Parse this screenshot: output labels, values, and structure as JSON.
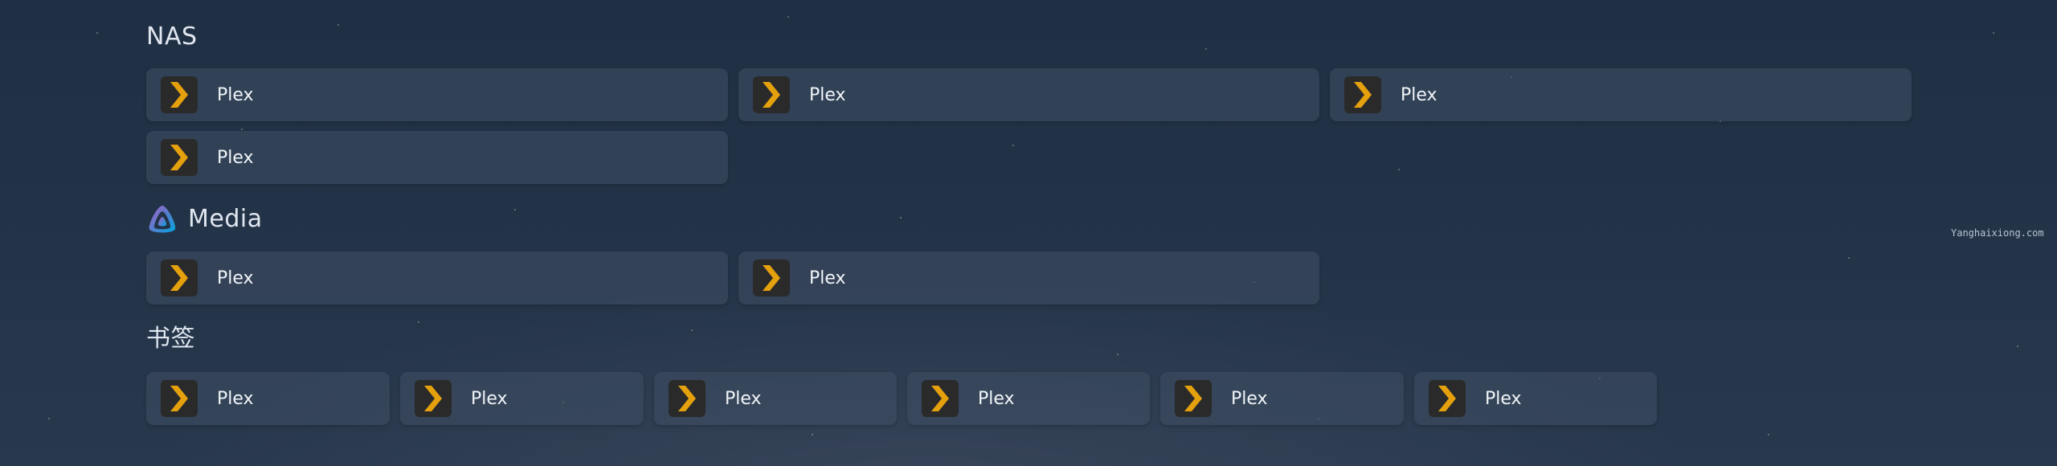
{
  "watermark": "Yanghaixiong.com",
  "sections": [
    {
      "title": "NAS",
      "items": [
        {
          "label": "Plex"
        },
        {
          "label": "Plex"
        },
        {
          "label": "Plex"
        },
        {
          "label": "Plex"
        }
      ]
    },
    {
      "title": "Media",
      "title_icon": "jellyfin-logo-icon",
      "items": [
        {
          "label": "Plex"
        },
        {
          "label": "Plex"
        }
      ]
    },
    {
      "title": "书签",
      "items": [
        {
          "label": "Plex"
        },
        {
          "label": "Plex"
        },
        {
          "label": "Plex"
        },
        {
          "label": "Plex"
        },
        {
          "label": "Plex"
        },
        {
          "label": "Plex"
        }
      ]
    }
  ],
  "item_icon": "plex-chevron-icon",
  "colors": {
    "plex_chevron": "#e5a00d",
    "icon_bg": "#2a2a2a",
    "card_bg": "#3e4e62",
    "background": "#233347"
  }
}
